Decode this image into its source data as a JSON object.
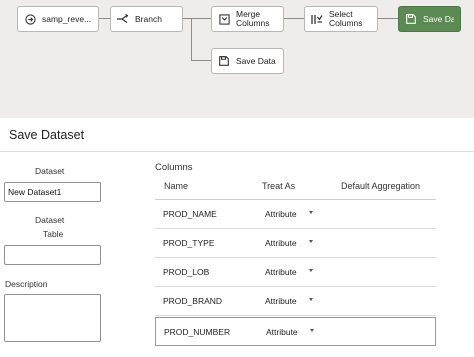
{
  "flow": {
    "nodes": [
      {
        "id": "source",
        "label": "samp_reve...",
        "icon": "circle-arrow-icon"
      },
      {
        "id": "branch",
        "label": "Branch",
        "icon": "branch-icon"
      },
      {
        "id": "merge",
        "label": "Merge Columns",
        "label_lines": [
          "Merge",
          "Columns"
        ],
        "icon": "merge-columns-icon"
      },
      {
        "id": "select",
        "label": "Select Columns",
        "label_lines": [
          "Select",
          "Columns"
        ],
        "icon": "select-columns-icon"
      },
      {
        "id": "save_active",
        "label": "Save Data",
        "icon": "save-icon",
        "active": true
      },
      {
        "id": "save_branch",
        "label": "Save Data",
        "icon": "save-icon"
      }
    ]
  },
  "panel": {
    "title": "Save Dataset",
    "dataset_label": "Dataset",
    "dataset_value": "New Dataset1",
    "table_label_1": "Dataset",
    "table_label_2": "Table",
    "table_value": "",
    "description_label": "Description",
    "description_value": ""
  },
  "columns": {
    "title": "Columns",
    "headers": [
      "Name",
      "Treat As",
      "Default Aggregation"
    ],
    "rows": [
      {
        "name": "PROD_NAME",
        "treat_as": "Attribute",
        "aggregation": ""
      },
      {
        "name": "PROD_TYPE",
        "treat_as": "Attribute",
        "aggregation": ""
      },
      {
        "name": "PROD_LOB",
        "treat_as": "Attribute",
        "aggregation": ""
      },
      {
        "name": "PROD_BRAND",
        "treat_as": "Attribute",
        "aggregation": ""
      },
      {
        "name": "PROD_NUMBER",
        "treat_as": "Attribute",
        "aggregation": ""
      }
    ]
  },
  "colors": {
    "active_node": "#5b8a52",
    "canvas_bg": "#eeedeb"
  }
}
